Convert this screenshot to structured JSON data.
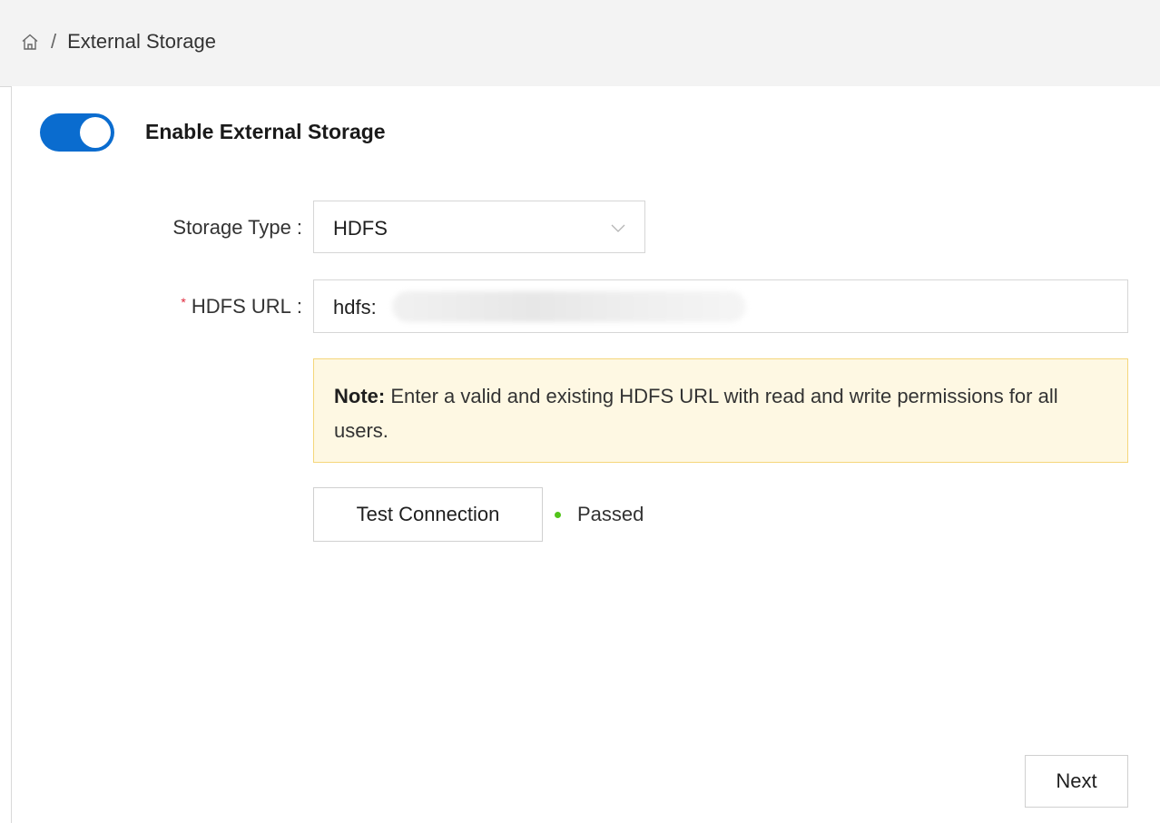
{
  "breadcrumb": {
    "home_icon": "home-icon",
    "separator": "/",
    "current": "External Storage"
  },
  "toggle": {
    "label": "Enable External Storage",
    "enabled": true,
    "color": "#0a6ccf"
  },
  "form": {
    "storage_type": {
      "label": "Storage Type",
      "colon": ":",
      "value": "HDFS"
    },
    "hdfs_url": {
      "required_mark": "*",
      "label": "HDFS URL",
      "colon": ":",
      "value": "hdfs:"
    }
  },
  "note": {
    "strong": "Note:",
    "text": " Enter a valid and existing HDFS URL with read and write permissions for all users."
  },
  "test": {
    "button_label": "Test Connection",
    "status": "Passed",
    "status_color": "#52c41a"
  },
  "footer": {
    "next_label": "Next"
  }
}
